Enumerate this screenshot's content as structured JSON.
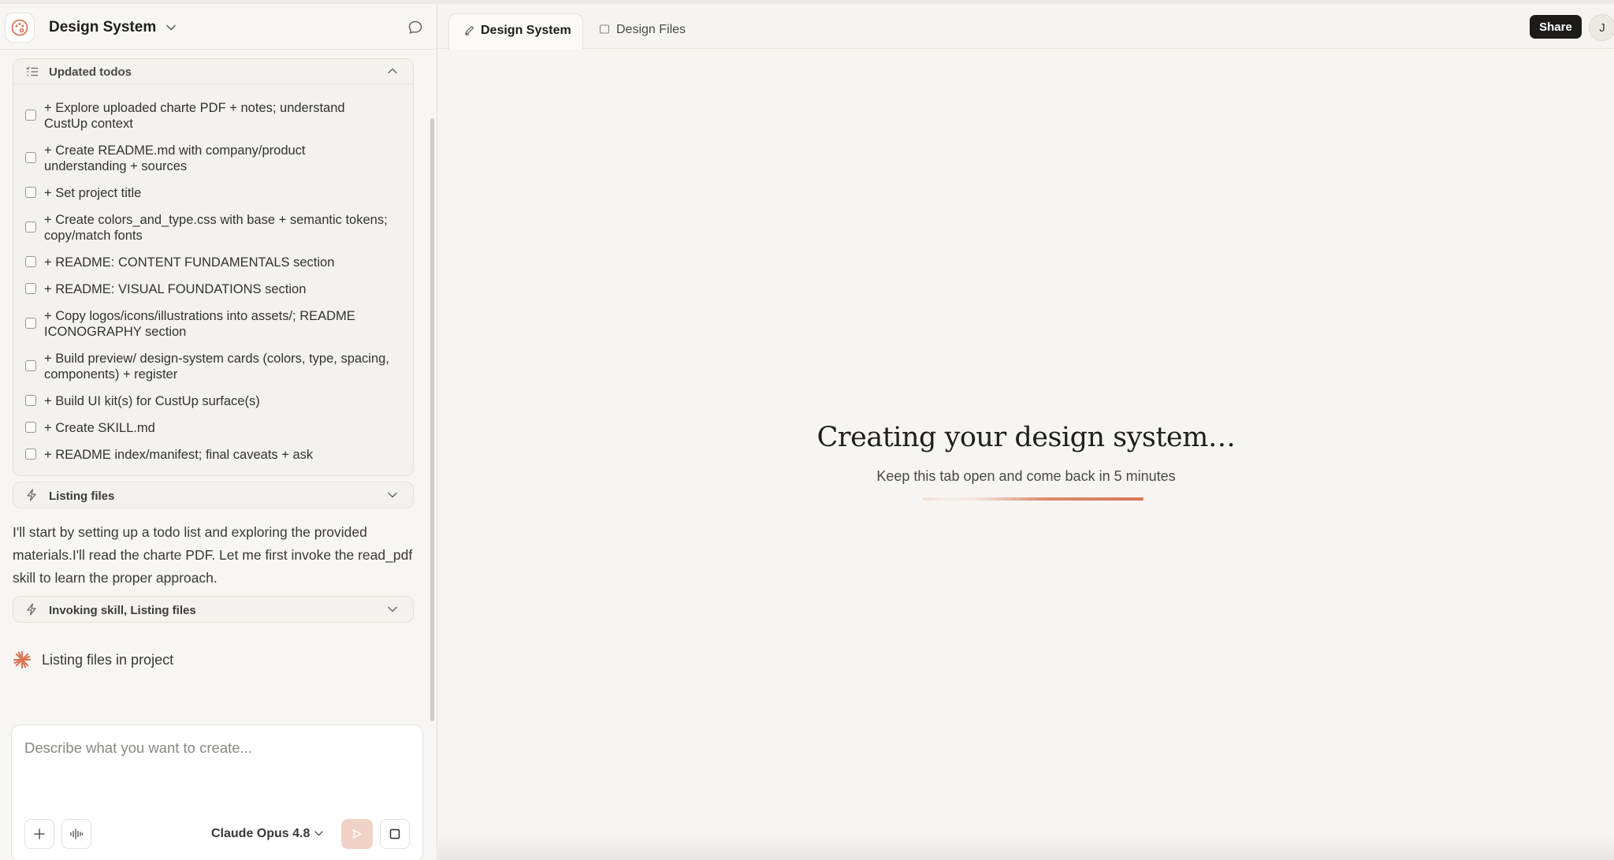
{
  "header": {
    "project_title": "Design System",
    "logo_icon": "palette-icon"
  },
  "todos": {
    "title": "Updated todos",
    "items": [
      "+ Explore uploaded charte PDF + notes; understand CustUp context",
      "+ Create README.md with company/product understanding + sources",
      "+ Set project title",
      "+ Create colors_and_type.css with base + semantic tokens; copy/match fonts",
      "+ README: CONTENT FUNDAMENTALS section",
      "+ README: VISUAL FOUNDATIONS section",
      "+ Copy logos/icons/illustrations into assets/; README ICONOGRAPHY section",
      "+ Build preview/ design-system cards (colors, type, spacing, components) + register",
      "+ Build UI kit(s) for CustUp surface(s)",
      "+ Create SKILL.md",
      "+ README index/manifest; final caveats + ask"
    ]
  },
  "steps": {
    "listing_files": "Listing files",
    "invoking_skill": "Invoking skill, Listing files"
  },
  "message": "I'll start by setting up a todo list and exploring the provided materials.I'll read the charte PDF. Let me first invoke the read_pdf skill to learn the proper approach.",
  "status": {
    "text": "Listing files in project",
    "accent": "#d97757"
  },
  "composer": {
    "placeholder": "Describe what you want to create...",
    "model": "Claude Opus 4.8"
  },
  "tabs": [
    {
      "label": "Design System",
      "icon": "pen-icon",
      "active": true
    },
    {
      "label": "Design Files",
      "icon": "file-icon",
      "active": false
    }
  ],
  "toolbar": {
    "share_label": "Share",
    "avatar_initial": "J"
  },
  "loading": {
    "title": "Creating your design system…",
    "subtitle": "Keep this tab open and come back in 5 minutes",
    "accent": "#d97757"
  }
}
